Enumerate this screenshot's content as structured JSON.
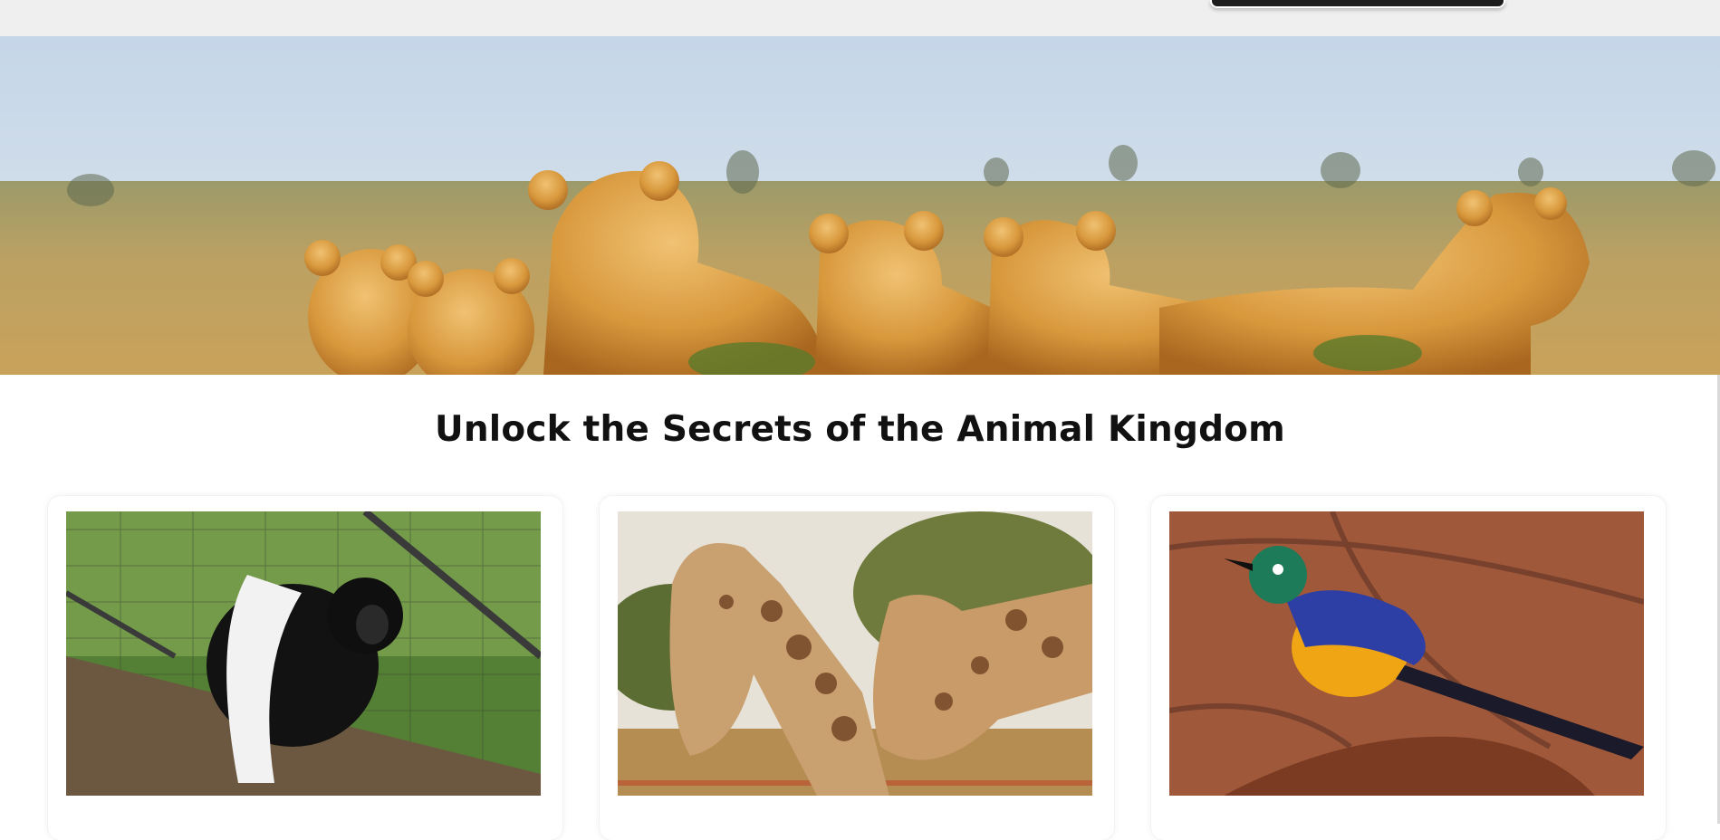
{
  "page": {
    "headline": "Unlock the Secrets of the Animal Kingdom"
  },
  "hero": {
    "image_icon": "lion-pride-image"
  },
  "cards": [
    {
      "image_icon": "colobus-monkey-image",
      "caption": ""
    },
    {
      "image_icon": "giraffes-image",
      "caption": ""
    },
    {
      "image_icon": "starling-bird-image",
      "caption": ""
    }
  ],
  "colors": {
    "topbar": "#efefef",
    "sky": "#c9d8e8",
    "grass": "#b59a55",
    "lion": "#d89a3d",
    "text": "#111111"
  }
}
